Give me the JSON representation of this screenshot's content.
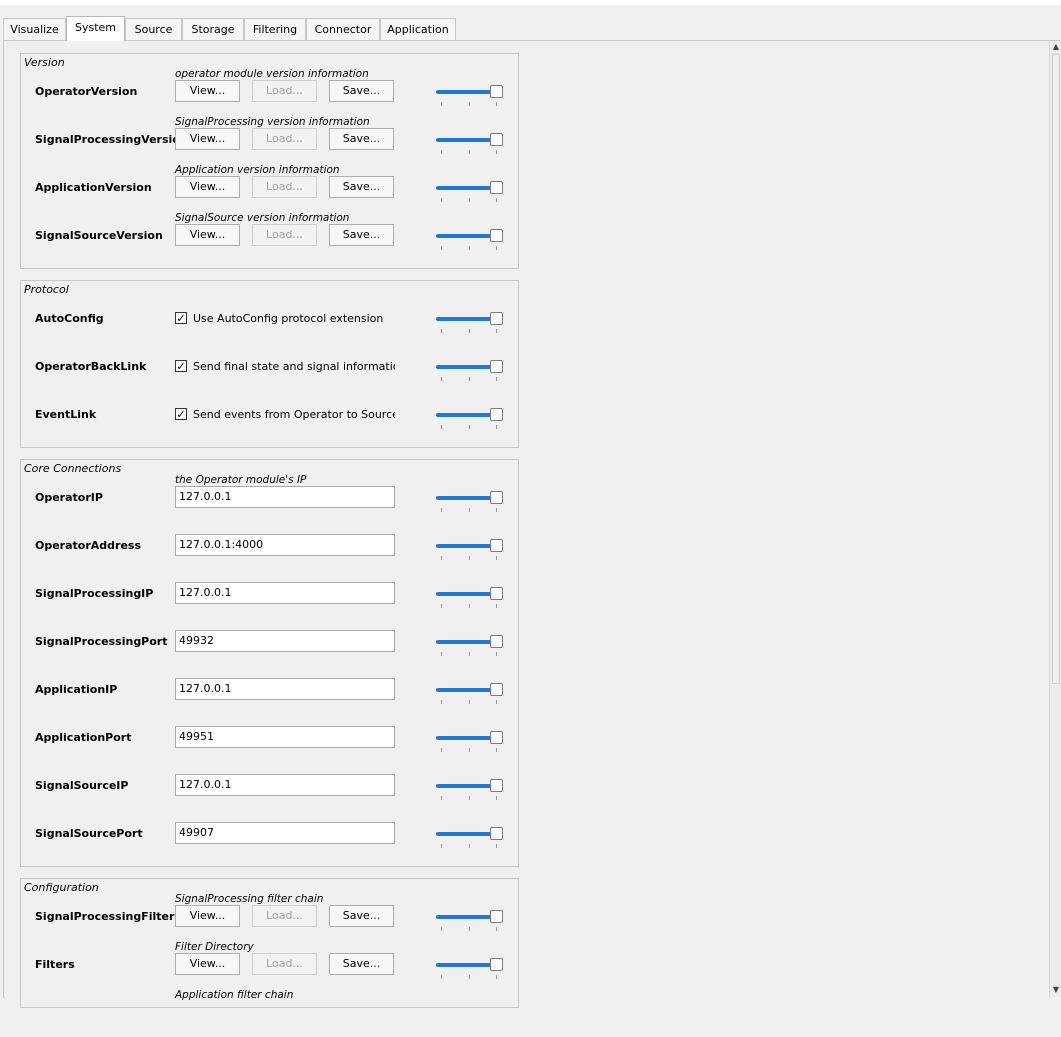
{
  "tabs": [
    {
      "label": "Visualize",
      "active": false
    },
    {
      "label": "System",
      "active": true
    },
    {
      "label": "Source",
      "active": false
    },
    {
      "label": "Storage",
      "active": false
    },
    {
      "label": "Filtering",
      "active": false
    },
    {
      "label": "Connector",
      "active": false
    },
    {
      "label": "Application",
      "active": false
    }
  ],
  "buttons": {
    "view": "View...",
    "load": "Load...",
    "save": "Save..."
  },
  "scrollbar": {
    "up": "▲",
    "down": "▼"
  },
  "groups": {
    "version": {
      "title": "Version",
      "rows": [
        {
          "name": "OperatorVersion",
          "comment": "operator module version information"
        },
        {
          "name": "SignalProcessingVersion",
          "comment": "SignalProcessing version information"
        },
        {
          "name": "ApplicationVersion",
          "comment": "Application version information"
        },
        {
          "name": "SignalSourceVersion",
          "comment": "SignalSource version information"
        }
      ]
    },
    "protocol": {
      "title": "Protocol",
      "rows": [
        {
          "name": "AutoConfig",
          "check_label": "Use AutoConfig protocol extension",
          "checked": true
        },
        {
          "name": "OperatorBackLink",
          "check_label": "Send final state and signal information to Operator",
          "checked": true
        },
        {
          "name": "EventLink",
          "check_label": "Send events from Operator to Source module",
          "checked": true
        }
      ]
    },
    "core": {
      "title": "Core Connections",
      "rows": [
        {
          "name": "OperatorIP",
          "comment": "the Operator module's IP",
          "value": "127.0.0.1"
        },
        {
          "name": "OperatorAddress",
          "comment": "",
          "value": "127.0.0.1:4000"
        },
        {
          "name": "SignalProcessingIP",
          "comment": "",
          "value": "127.0.0.1"
        },
        {
          "name": "SignalProcessingPort",
          "comment": "",
          "value": "49932"
        },
        {
          "name": "ApplicationIP",
          "comment": "",
          "value": "127.0.0.1"
        },
        {
          "name": "ApplicationPort",
          "comment": "",
          "value": "49951"
        },
        {
          "name": "SignalSourceIP",
          "comment": "",
          "value": "127.0.0.1"
        },
        {
          "name": "SignalSourcePort",
          "comment": "",
          "value": "49907"
        }
      ]
    },
    "config": {
      "title": "Configuration",
      "rows": [
        {
          "name": "SignalProcessingFilterChain",
          "comment": "SignalProcessing filter chain"
        },
        {
          "name": "Filters",
          "comment": "Filter Directory"
        },
        {
          "name": "",
          "comment": "Application filter chain"
        }
      ]
    }
  }
}
